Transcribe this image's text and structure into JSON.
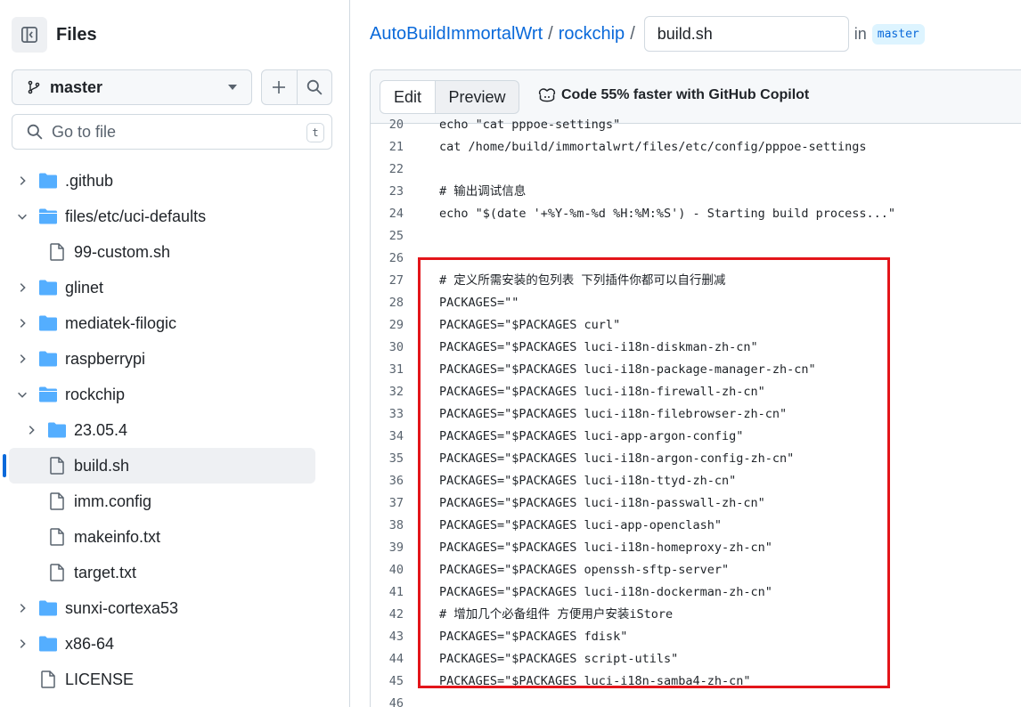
{
  "sidebar": {
    "title": "Files",
    "branch": "master",
    "goto_placeholder": "Go to file",
    "goto_shortcut": "t",
    "tree": [
      {
        "label": ".github",
        "type": "folder",
        "depth": 0,
        "expanded": false
      },
      {
        "label": "files/etc/uci-defaults",
        "type": "folder",
        "depth": 0,
        "expanded": true
      },
      {
        "label": "99-custom.sh",
        "type": "file",
        "depth": 1
      },
      {
        "label": "glinet",
        "type": "folder",
        "depth": 0,
        "expanded": false
      },
      {
        "label": "mediatek-filogic",
        "type": "folder",
        "depth": 0,
        "expanded": false
      },
      {
        "label": "raspberrypi",
        "type": "folder",
        "depth": 0,
        "expanded": false
      },
      {
        "label": "rockchip",
        "type": "folder",
        "depth": 0,
        "expanded": true
      },
      {
        "label": "23.05.4",
        "type": "folder",
        "depth": 1,
        "expanded": false
      },
      {
        "label": "build.sh",
        "type": "file",
        "depth": 1,
        "selected": true
      },
      {
        "label": "imm.config",
        "type": "file",
        "depth": 1
      },
      {
        "label": "makeinfo.txt",
        "type": "file",
        "depth": 1
      },
      {
        "label": "target.txt",
        "type": "file",
        "depth": 1
      },
      {
        "label": "sunxi-cortexa53",
        "type": "folder",
        "depth": 0,
        "expanded": false
      },
      {
        "label": "x86-64",
        "type": "folder",
        "depth": 0,
        "expanded": false
      },
      {
        "label": "LICENSE",
        "type": "file",
        "depth": 0
      }
    ]
  },
  "breadcrumb": {
    "repo": "AutoBuildImmortalWrt",
    "folder": "rockchip",
    "filename": "build.sh",
    "in_label": "in",
    "branch": "master"
  },
  "editor": {
    "tab_edit": "Edit",
    "tab_preview": "Preview",
    "copilot_text": "Code 55% faster with GitHub Copilot",
    "lines": [
      {
        "n": "20",
        "text": "echo \"cat pppoe-settings\""
      },
      {
        "n": "21",
        "text": "cat /home/build/immortalwrt/files/etc/config/pppoe-settings"
      },
      {
        "n": "22",
        "text": ""
      },
      {
        "n": "23",
        "text": "# 输出调试信息"
      },
      {
        "n": "24",
        "text": "echo \"$(date '+%Y-%m-%d %H:%M:%S') - Starting build process...\""
      },
      {
        "n": "25",
        "text": ""
      },
      {
        "n": "26",
        "text": ""
      },
      {
        "n": "27",
        "text": "# 定义所需安装的包列表 下列插件你都可以自行删减"
      },
      {
        "n": "28",
        "text": "PACKAGES=\"\""
      },
      {
        "n": "29",
        "text": "PACKAGES=\"$PACKAGES curl\""
      },
      {
        "n": "30",
        "text": "PACKAGES=\"$PACKAGES luci-i18n-diskman-zh-cn\""
      },
      {
        "n": "31",
        "text": "PACKAGES=\"$PACKAGES luci-i18n-package-manager-zh-cn\""
      },
      {
        "n": "32",
        "text": "PACKAGES=\"$PACKAGES luci-i18n-firewall-zh-cn\""
      },
      {
        "n": "33",
        "text": "PACKAGES=\"$PACKAGES luci-i18n-filebrowser-zh-cn\""
      },
      {
        "n": "34",
        "text": "PACKAGES=\"$PACKAGES luci-app-argon-config\""
      },
      {
        "n": "35",
        "text": "PACKAGES=\"$PACKAGES luci-i18n-argon-config-zh-cn\""
      },
      {
        "n": "36",
        "text": "PACKAGES=\"$PACKAGES luci-i18n-ttyd-zh-cn\""
      },
      {
        "n": "37",
        "text": "PACKAGES=\"$PACKAGES luci-i18n-passwall-zh-cn\""
      },
      {
        "n": "38",
        "text": "PACKAGES=\"$PACKAGES luci-app-openclash\""
      },
      {
        "n": "39",
        "text": "PACKAGES=\"$PACKAGES luci-i18n-homeproxy-zh-cn\""
      },
      {
        "n": "40",
        "text": "PACKAGES=\"$PACKAGES openssh-sftp-server\""
      },
      {
        "n": "41",
        "text": "PACKAGES=\"$PACKAGES luci-i18n-dockerman-zh-cn\""
      },
      {
        "n": "42",
        "text": "# 增加几个必备组件 方便用户安装iStore"
      },
      {
        "n": "43",
        "text": "PACKAGES=\"$PACKAGES fdisk\""
      },
      {
        "n": "44",
        "text": "PACKAGES=\"$PACKAGES script-utils\""
      },
      {
        "n": "45",
        "text": "PACKAGES=\"$PACKAGES luci-i18n-samba4-zh-cn\""
      },
      {
        "n": "46",
        "text": ""
      }
    ]
  },
  "colors": {
    "link": "#0969da",
    "folder": "#54aeff",
    "highlight_border": "#e3151a",
    "selected_bg": "#eef0f3"
  }
}
